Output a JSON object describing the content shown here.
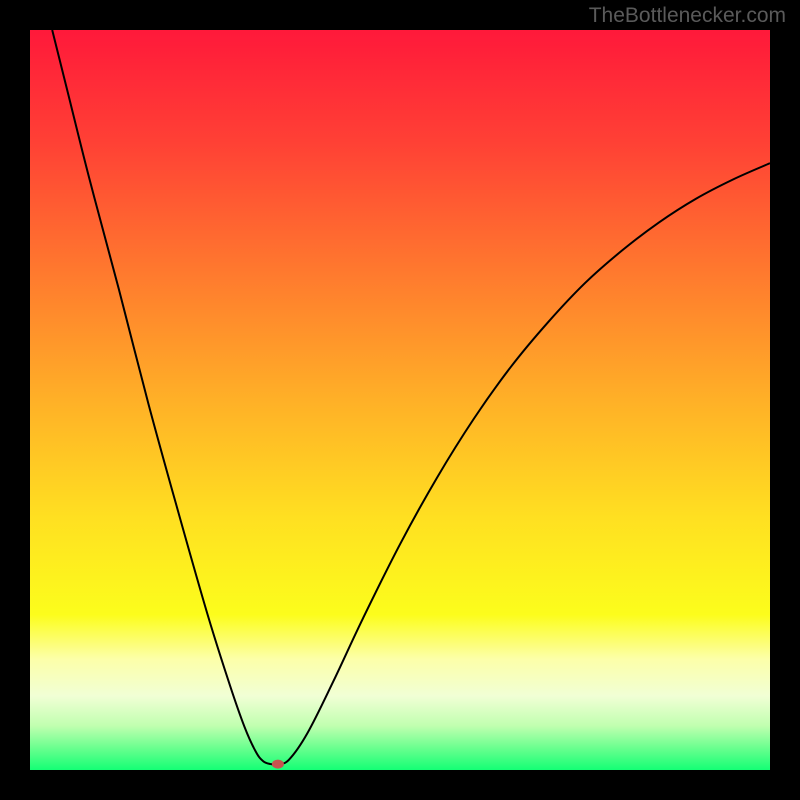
{
  "watermark": "TheBottlenecker.com",
  "chart_data": {
    "type": "line",
    "title": "",
    "xlabel": "",
    "ylabel": "",
    "xlim": [
      0,
      100
    ],
    "ylim": [
      0,
      100
    ],
    "background_gradient": {
      "stops": [
        {
          "pos": 0.0,
          "color": "#ff193a"
        },
        {
          "pos": 0.15,
          "color": "#ff4035"
        },
        {
          "pos": 0.33,
          "color": "#ff7a2e"
        },
        {
          "pos": 0.5,
          "color": "#ffb027"
        },
        {
          "pos": 0.66,
          "color": "#ffe021"
        },
        {
          "pos": 0.79,
          "color": "#fcfd1c"
        },
        {
          "pos": 0.85,
          "color": "#fcffa9"
        },
        {
          "pos": 0.9,
          "color": "#f1ffd5"
        },
        {
          "pos": 0.94,
          "color": "#c1ffb0"
        },
        {
          "pos": 0.97,
          "color": "#6bff8f"
        },
        {
          "pos": 1.0,
          "color": "#14ff75"
        }
      ]
    },
    "series": [
      {
        "name": "bottleneck-curve",
        "color": "#000000",
        "width": 2,
        "points": [
          {
            "x": 3.0,
            "y": 100.0
          },
          {
            "x": 5.0,
            "y": 92.0
          },
          {
            "x": 8.0,
            "y": 80.0
          },
          {
            "x": 12.0,
            "y": 65.0
          },
          {
            "x": 16.0,
            "y": 49.5
          },
          {
            "x": 20.0,
            "y": 35.0
          },
          {
            "x": 24.0,
            "y": 21.0
          },
          {
            "x": 27.0,
            "y": 11.5
          },
          {
            "x": 29.0,
            "y": 5.8
          },
          {
            "x": 30.5,
            "y": 2.5
          },
          {
            "x": 31.5,
            "y": 1.2
          },
          {
            "x": 32.5,
            "y": 0.8
          },
          {
            "x": 33.5,
            "y": 0.8
          },
          {
            "x": 35.0,
            "y": 1.4
          },
          {
            "x": 37.5,
            "y": 5.0
          },
          {
            "x": 41.0,
            "y": 12.0
          },
          {
            "x": 45.0,
            "y": 20.5
          },
          {
            "x": 50.0,
            "y": 30.5
          },
          {
            "x": 55.0,
            "y": 39.5
          },
          {
            "x": 60.0,
            "y": 47.5
          },
          {
            "x": 65.0,
            "y": 54.5
          },
          {
            "x": 70.0,
            "y": 60.5
          },
          {
            "x": 75.0,
            "y": 65.8
          },
          {
            "x": 80.0,
            "y": 70.2
          },
          {
            "x": 85.0,
            "y": 74.0
          },
          {
            "x": 90.0,
            "y": 77.2
          },
          {
            "x": 95.0,
            "y": 79.8
          },
          {
            "x": 100.0,
            "y": 82.0
          }
        ]
      }
    ],
    "marker": {
      "x": 33.5,
      "y": 0.8,
      "rx": 6,
      "ry": 4.5,
      "color": "#c6544f"
    }
  }
}
